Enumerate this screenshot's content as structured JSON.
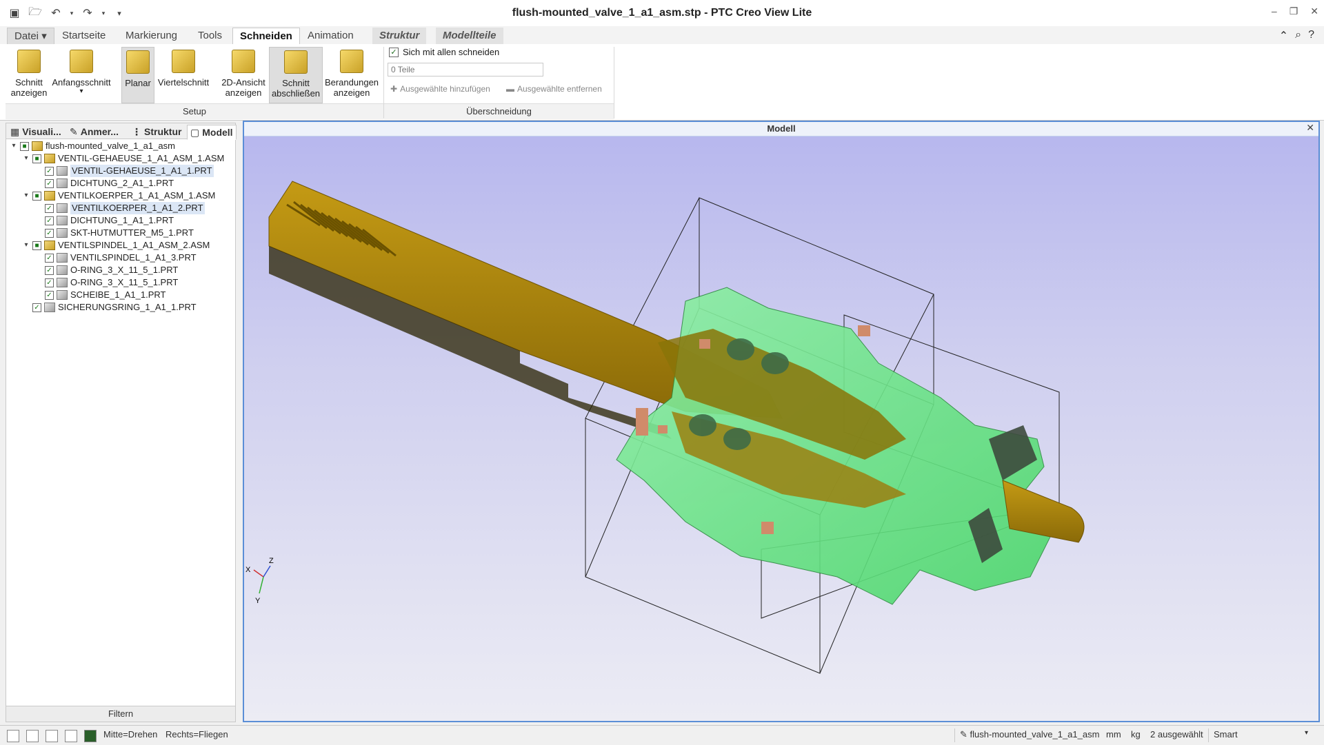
{
  "window": {
    "title": "flush-mounted_valve_1_a1_asm.stp - PTC Creo View Lite"
  },
  "tabs": {
    "datei": "Datei",
    "items": [
      "Startseite",
      "Markierung",
      "Tools",
      "Schneiden",
      "Animation"
    ],
    "active": "Schneiden",
    "contextual": [
      "Struktur",
      "Modellteile"
    ]
  },
  "ribbon": {
    "buttons": [
      {
        "line1": "Schnitt",
        "line2": "anzeigen"
      },
      {
        "line1": "Anfangsschnitt",
        "line2": "▾"
      },
      {
        "line1": "Planar",
        "line2": ""
      },
      {
        "line1": "Viertelschnitt",
        "line2": ""
      },
      {
        "line1": "2D-Ansicht",
        "line2": "anzeigen"
      },
      {
        "line1": "Schnitt",
        "line2": "abschließen"
      },
      {
        "line1": "Berandungen",
        "line2": "anzeigen"
      }
    ],
    "group_setup": "Setup",
    "group_intersection": "Überschneidung",
    "checkbox_all": "Sich mit allen schneiden",
    "parts_placeholder": "0 Teile",
    "add_selected": "Ausgewählte hinzufügen",
    "remove_selected": "Ausgewählte entfernen"
  },
  "panel": {
    "tabs": [
      "Visuali...",
      "Anmer...",
      "Struktur",
      "Modell"
    ],
    "tree": [
      {
        "label": "flush-mounted_valve_1_a1_asm",
        "level": 0,
        "type": "asm",
        "expanded": true
      },
      {
        "label": "VENTIL-GEHAEUSE_1_A1_ASM_1.ASM",
        "level": 1,
        "type": "asm",
        "expanded": true
      },
      {
        "label": "VENTIL-GEHAEUSE_1_A1_1.PRT",
        "level": 2,
        "type": "prt",
        "highlight": true
      },
      {
        "label": "DICHTUNG_2_A1_1.PRT",
        "level": 2,
        "type": "prt"
      },
      {
        "label": "VENTILKOERPER_1_A1_ASM_1.ASM",
        "level": 1,
        "type": "asm",
        "expanded": true
      },
      {
        "label": "VENTILKOERPER_1_A1_2.PRT",
        "level": 2,
        "type": "prt",
        "highlight": true
      },
      {
        "label": "DICHTUNG_1_A1_1.PRT",
        "level": 2,
        "type": "prt"
      },
      {
        "label": "SKT-HUTMUTTER_M5_1.PRT",
        "level": 2,
        "type": "prt"
      },
      {
        "label": "VENTILSPINDEL_1_A1_ASM_2.ASM",
        "level": 1,
        "type": "asm",
        "expanded": true
      },
      {
        "label": "VENTILSPINDEL_1_A1_3.PRT",
        "level": 2,
        "type": "prt"
      },
      {
        "label": "O-RING_3_X_11_5_1.PRT",
        "level": 2,
        "type": "prt"
      },
      {
        "label": "O-RING_3_X_11_5_1.PRT",
        "level": 2,
        "type": "prt"
      },
      {
        "label": "SCHEIBE_1_A1_1.PRT",
        "level": 2,
        "type": "prt"
      },
      {
        "label": "SICHERUNGSRING_1_A1_1.PRT",
        "level": 1,
        "type": "prt"
      }
    ],
    "filter": "Filtern"
  },
  "viewport": {
    "title": "Modell",
    "axes": [
      "X",
      "Z",
      "Y"
    ]
  },
  "status": {
    "mouse_middle": "Mitte=Drehen",
    "mouse_right": "Rechts=Fliegen",
    "file": "flush-mounted_valve_1_a1_asm",
    "unit_length": "mm",
    "unit_mass": "kg",
    "selected": "2 ausgewählt",
    "mode": "Smart"
  }
}
